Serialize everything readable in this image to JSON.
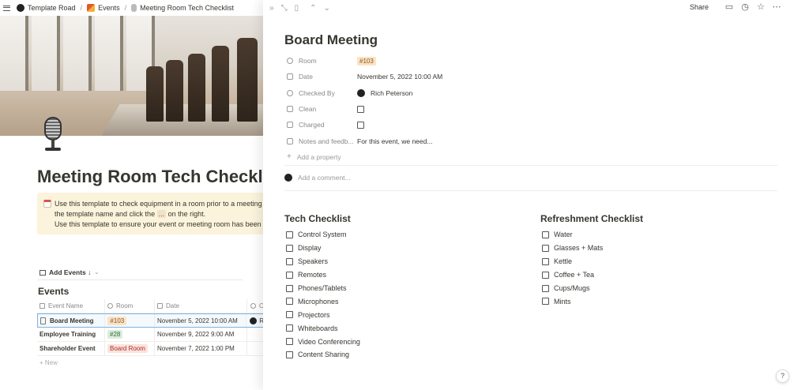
{
  "breadcrumb": {
    "items": [
      "Template Road",
      "Events",
      "Meeting Room Tech Checklist"
    ],
    "separator": "/"
  },
  "left_page": {
    "title": "Meeting Room Tech Checklist",
    "callout": {
      "line1": "Use this template to check equipment in a room prior to a meeting or",
      "line2_pre": "the template name and click the",
      "line2_code": "...",
      "line2_post": "on the right.",
      "line3": "Use this template to ensure your event or meeting room has been",
      "line3_code": "Ch"
    },
    "view_button": "Add Events ↓",
    "database_title": "Events",
    "columns": [
      "Event Name",
      "Room",
      "Date",
      "Ch"
    ],
    "rows": [
      {
        "name": "Board Meeting",
        "room": "#103",
        "room_color": "orange",
        "date": "November 5, 2022 10:00 AM",
        "checked_by": "Ri"
      },
      {
        "name": "Employee Training",
        "room": "#28",
        "room_color": "green",
        "date": "November 9, 2022 9:00 AM",
        "checked_by": ""
      },
      {
        "name": "Shareholder Event",
        "room": "Board Room",
        "room_color": "red",
        "date": "November 7, 2022 1:00 PM",
        "checked_by": ""
      }
    ],
    "new_label": "+ New"
  },
  "peek": {
    "toolbar": {
      "share": "Share",
      "icons": [
        "expand-icon",
        "open-full-icon",
        "sidepeek-icon",
        "up-icon",
        "down-icon",
        "comment-icon",
        "history-icon",
        "star-icon",
        "more-icon"
      ]
    },
    "title": "Board Meeting",
    "properties": {
      "room": {
        "label": "Room",
        "value": "#103"
      },
      "date": {
        "label": "Date",
        "value": "November 5, 2022 10:00 AM"
      },
      "checked_by": {
        "label": "Checked By",
        "value": "Rich Peterson"
      },
      "clean": {
        "label": "Clean"
      },
      "charged": {
        "label": "Charged"
      },
      "notes": {
        "label": "Notes and feedb...",
        "value": "For this event, we need..."
      }
    },
    "add_property": "Add a property",
    "add_comment": "Add a comment...",
    "tech_checklist": {
      "title": "Tech Checklist",
      "items": [
        "Control System",
        "Display",
        "Speakers",
        "Remotes",
        "Phones/Tablets",
        "Microphones",
        "Projectors",
        "Whiteboards",
        "Video Conferencing",
        "Content Sharing"
      ]
    },
    "refreshment_checklist": {
      "title": "Refreshment Checklist",
      "items": [
        "Water",
        "Glasses + Mats",
        "Kettle",
        "Coffee + Tea",
        "Cups/Mugs",
        "Mints"
      ]
    },
    "help": "?"
  },
  "colors": {
    "text": "#37352f",
    "muted": "#9b9a97",
    "callout_bg": "#fbf3db",
    "selected_row_border": "#7fb3e0",
    "tag_orange_bg": "#fae3c6",
    "tag_green_bg": "#dbeddb",
    "tag_red_bg": "#ffe2dd"
  }
}
